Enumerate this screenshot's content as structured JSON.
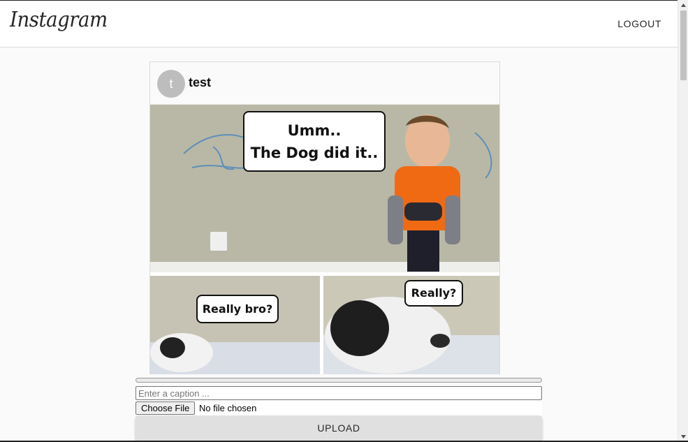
{
  "header": {
    "logo_text": "Instagram",
    "logout_label": "LOGOUT"
  },
  "post": {
    "avatar_initial": "t",
    "username": "test",
    "image_captions": {
      "main_line1": "Umm..",
      "main_line2": "The Dog did it..",
      "left": "Really bro?",
      "right": "Really?"
    }
  },
  "upload": {
    "progress_value": 0,
    "caption_placeholder": "Enter a caption ...",
    "caption_value": "",
    "choose_file_label": "Choose File",
    "no_file_text": "No file chosen",
    "upload_label": "UPLOAD"
  },
  "icons": {
    "scroll_up": "chevron-up-icon",
    "scroll_down": "chevron-down-icon"
  },
  "colors": {
    "background": "#fafafa",
    "header_bg": "#ffffff",
    "border": "#dbdbdb",
    "avatar_bg": "#bdbdbd",
    "upload_button_bg": "#e0e0e0"
  }
}
